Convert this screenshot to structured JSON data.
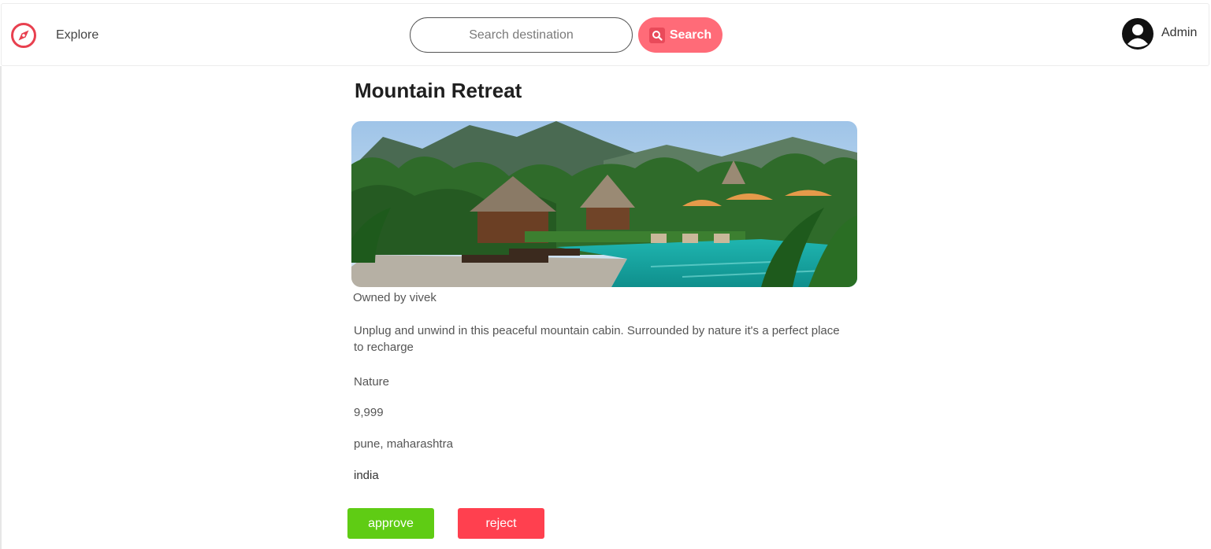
{
  "nav": {
    "explore_label": "Explore",
    "search_placeholder": "Search destination",
    "search_button_label": "Search",
    "user_label": "Admin"
  },
  "listing": {
    "title": "Mountain Retreat",
    "owner_text": "Owned by vivek",
    "description": "Unplug and unwind in this peaceful mountain cabin. Surrounded by nature it's a perfect place to recharge",
    "category": "Nature",
    "price": "9,999",
    "location": "pune, maharashtra",
    "country": "india"
  },
  "actions": {
    "approve_label": "approve",
    "reject_label": "reject"
  },
  "colors": {
    "brand": "#e8404f",
    "search_button": "#ff6b78",
    "approve": "#5fcc14",
    "reject": "#ff404f"
  }
}
